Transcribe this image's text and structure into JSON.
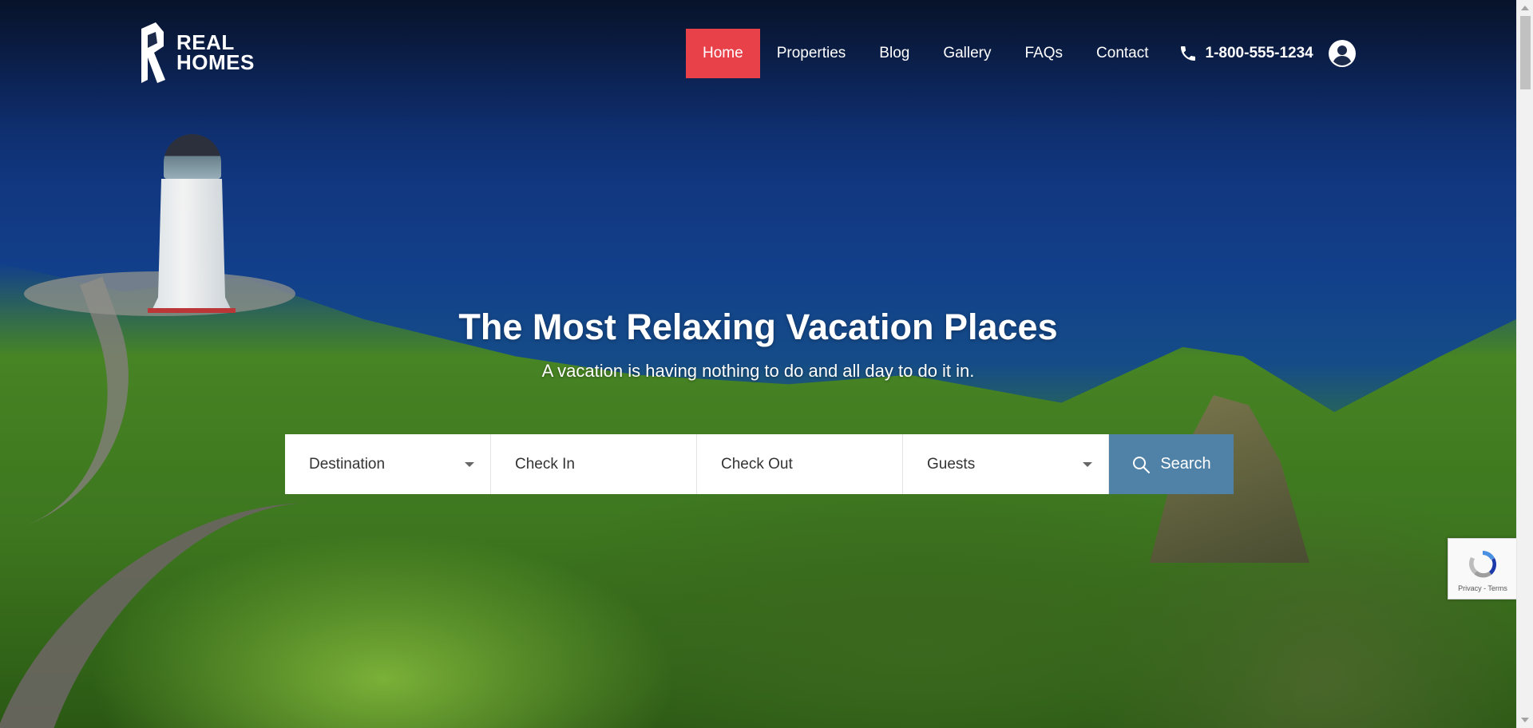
{
  "brand": {
    "line1": "REAL",
    "line2": "HOMES"
  },
  "nav": {
    "items": [
      {
        "label": "Home",
        "active": true
      },
      {
        "label": "Properties",
        "active": false
      },
      {
        "label": "Blog",
        "active": false
      },
      {
        "label": "Gallery",
        "active": false
      },
      {
        "label": "FAQs",
        "active": false
      },
      {
        "label": "Contact",
        "active": false
      }
    ],
    "phone": "1-800-555-1234",
    "active_color": "#e8414a"
  },
  "hero": {
    "title": "The Most Relaxing Vacation Places",
    "subtitle": "A vacation is having nothing to do and all day to do it in."
  },
  "search": {
    "destination": "Destination",
    "check_in": "Check In",
    "check_out": "Check Out",
    "guests": "Guests",
    "button": "Search",
    "button_color": "#5082a8"
  },
  "recaptcha": {
    "text": "Privacy - Terms"
  },
  "icons": [
    "logo-icon",
    "phone-icon",
    "user-icon",
    "search-icon",
    "recaptcha-icon"
  ]
}
